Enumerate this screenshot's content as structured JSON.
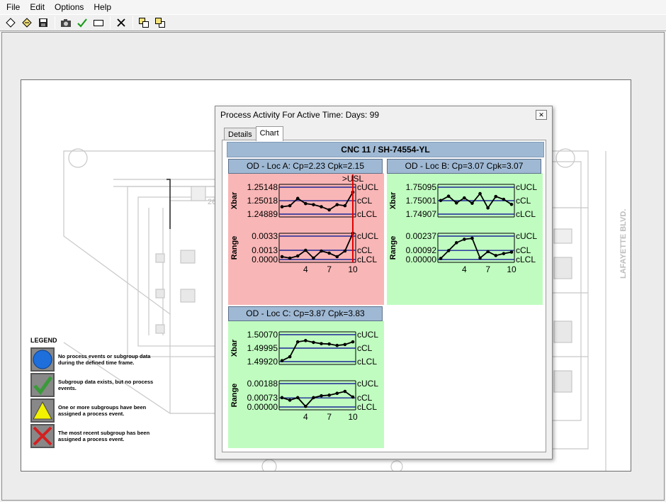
{
  "menu": [
    "File",
    "Edit",
    "Options",
    "Help"
  ],
  "toolbar": {
    "icons": [
      "new-icon",
      "open-icon",
      "save-icon",
      "camera-icon",
      "check-icon",
      "rectangle-icon",
      "delete-icon",
      "bring-front-icon",
      "send-back-icon"
    ]
  },
  "floorplan": {
    "street_label": "LAFAYETTE BLVD."
  },
  "legend": {
    "title": "LEGEND",
    "items": [
      {
        "text": "No process events or subgroup data during the defined time frame.",
        "icon": "blue-circle-icon",
        "color": "#1e6fdc"
      },
      {
        "text": "Subgroup data exists, but no process events.",
        "icon": "green-check-icon",
        "color": "#3a9a3a"
      },
      {
        "text": "One or more subgroups have been assigned a process event.",
        "icon": "yellow-triangle-icon",
        "color": "#f2f200"
      },
      {
        "text": "The most recent subgroup has been assigned a process event.",
        "icon": "red-x-icon",
        "color": "#d42020"
      }
    ]
  },
  "dialog": {
    "title": "Process Activity For Active Time: Days: 99",
    "tabs": [
      "Details",
      "Chart"
    ],
    "active_tab": "Chart",
    "chart_header": "CNC 11 / SH-74554-YL"
  },
  "colors": {
    "alarm_bg": "#f9b6b6",
    "ok_bg": "#c0fcc0",
    "header_bg": "#9fb9d4",
    "limit_line": "#1c2796",
    "usl_line": "#e00000"
  },
  "chart_data": [
    {
      "type": "line",
      "title": "OD - Loc A: Cp=2.23 Cpk=2.15",
      "status": "alarm",
      "usl_label": ">USL",
      "xbar": {
        "ylabel": "Xbar",
        "ticks": [
          "1.25148",
          "1.25018",
          "1.24889"
        ],
        "limits": {
          "ucl": 1.25148,
          "cl": 1.25018,
          "lcl": 1.24889
        },
        "ylim": [
          1.2486,
          1.2515
        ],
        "x": [
          1,
          2,
          3,
          4,
          5,
          6,
          7,
          8,
          9,
          10
        ],
        "values": [
          1.2496,
          1.2497,
          1.2504,
          1.2499,
          1.2498,
          1.2496,
          1.2493,
          1.2498,
          1.2497,
          1.251
        ]
      },
      "range": {
        "ylabel": "Range",
        "ticks": [
          "0.0033",
          "0.0013",
          "0.0000"
        ],
        "limits": {
          "ucl": 0.0033,
          "cl": 0.0013,
          "lcl": 0.0
        },
        "ylim": [
          0,
          0.0038
        ],
        "x": [
          1,
          2,
          3,
          4,
          5,
          6,
          7,
          8,
          9,
          10
        ],
        "values": [
          0.0004,
          0.0002,
          0.0005,
          0.0013,
          0.0002,
          0.0012,
          0.0009,
          0.0004,
          0.0012,
          0.0037
        ]
      },
      "limit_labels": [
        "cUCL",
        "cCL",
        "cLCL"
      ],
      "xticks": [
        "4",
        "7",
        "10"
      ]
    },
    {
      "type": "line",
      "title": "OD - Loc B: Cp=3.07 Cpk=3.07",
      "status": "ok",
      "xbar": {
        "ylabel": "Xbar",
        "ticks": [
          "1.75095",
          "1.75001",
          "1.74907"
        ],
        "limits": {
          "ucl": 1.75095,
          "cl": 1.75001,
          "lcl": 1.74907
        },
        "ylim": [
          1.7489,
          1.7511
        ],
        "x": [
          1,
          2,
          3,
          4,
          5,
          6,
          7,
          8,
          9,
          10
        ],
        "values": [
          1.75002,
          1.75032,
          1.74985,
          1.7502,
          1.74983,
          1.7505,
          1.7495,
          1.7503,
          1.7501,
          1.74975
        ]
      },
      "range": {
        "ylabel": "Range",
        "ticks": [
          "0.00237",
          "0.00092",
          "0.00000"
        ],
        "limits": {
          "ucl": 0.00237,
          "cl": 0.00092,
          "lcl": 0.0
        },
        "ylim": [
          0,
          0.0026
        ],
        "x": [
          1,
          2,
          3,
          4,
          5,
          6,
          7,
          8,
          9,
          10
        ],
        "values": [
          0.0001,
          0.0009,
          0.0017,
          0.00205,
          0.00215,
          0.00015,
          0.0008,
          0.0004,
          0.0006,
          0.00075
        ]
      },
      "limit_labels": [
        "cUCL",
        "cCL",
        "cLCL"
      ],
      "xticks": [
        "4",
        "7",
        "10"
      ]
    },
    {
      "type": "line",
      "title": "OD - Loc C: Cp=3.87 Cpk=3.83",
      "status": "ok",
      "xbar": {
        "ylabel": "Xbar",
        "ticks": [
          "1.50070",
          "1.49995",
          "1.49920"
        ],
        "limits": {
          "ucl": 1.5007,
          "cl": 1.49995,
          "lcl": 1.4992
        },
        "ylim": [
          1.4991,
          1.5008
        ],
        "x": [
          1,
          2,
          3,
          4,
          5,
          6,
          7,
          8,
          9,
          10
        ],
        "values": [
          1.49925,
          1.49947,
          1.5003,
          1.50037,
          1.50027,
          1.5002,
          1.50018,
          1.5001,
          1.50015,
          1.5003
        ]
      },
      "range": {
        "ylabel": "Range",
        "ticks": [
          "0.00188",
          "0.00073",
          "0.00000"
        ],
        "limits": {
          "ucl": 0.00188,
          "cl": 0.00073,
          "lcl": 0.0
        },
        "ylim": [
          0,
          0.0021
        ],
        "x": [
          1,
          2,
          3,
          4,
          5,
          6,
          7,
          8,
          9,
          10
        ],
        "values": [
          0.00075,
          0.00055,
          0.00075,
          5e-05,
          0.00075,
          0.0009,
          0.00095,
          0.0011,
          0.00125,
          0.0008
        ]
      },
      "limit_labels": [
        "cUCL",
        "cCL",
        "cLCL"
      ],
      "xticks": [
        "4",
        "7",
        "10"
      ]
    }
  ]
}
